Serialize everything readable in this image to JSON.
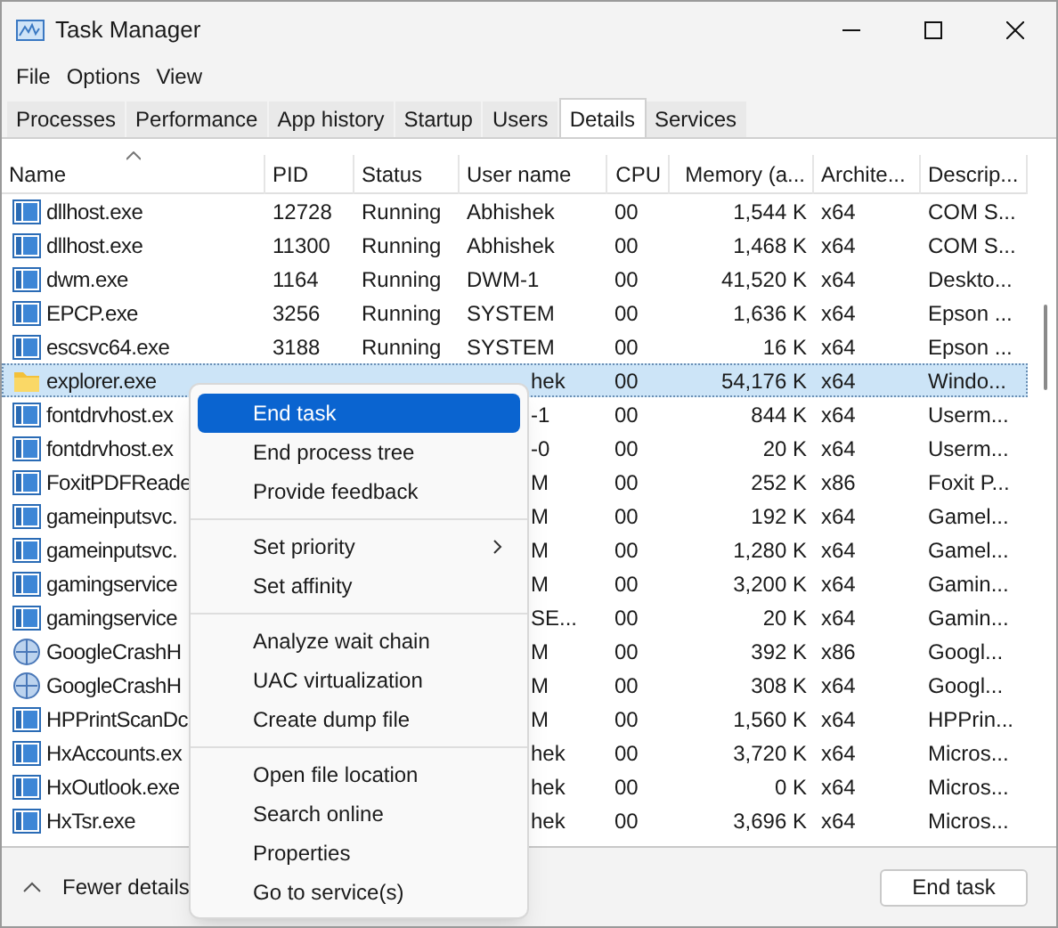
{
  "window": {
    "title": "Task Manager"
  },
  "menu_bar": [
    "File",
    "Options",
    "View"
  ],
  "tabs": [
    {
      "label": "Processes",
      "selected": false
    },
    {
      "label": "Performance",
      "selected": false
    },
    {
      "label": "App history",
      "selected": false
    },
    {
      "label": "Startup",
      "selected": false
    },
    {
      "label": "Users",
      "selected": false
    },
    {
      "label": "Details",
      "selected": true
    },
    {
      "label": "Services",
      "selected": false
    }
  ],
  "table": {
    "columns": [
      "Name",
      "PID",
      "Status",
      "User name",
      "CPU",
      "Memory (a...",
      "Archite...",
      "Descrip..."
    ],
    "rows": [
      {
        "kind": "app",
        "name": "dllhost.exe",
        "pid": "12728",
        "status": "Running",
        "user": "Abhishek",
        "cpu": "00",
        "memory": "1,544 K",
        "arch": "x64",
        "description": "COM S...",
        "selected": false
      },
      {
        "kind": "app",
        "name": "dllhost.exe",
        "pid": "11300",
        "status": "Running",
        "user": "Abhishek",
        "cpu": "00",
        "memory": "1,468 K",
        "arch": "x64",
        "description": "COM S...",
        "selected": false
      },
      {
        "kind": "app",
        "name": "dwm.exe",
        "pid": "1164",
        "status": "Running",
        "user": "DWM-1",
        "cpu": "00",
        "memory": "41,520 K",
        "arch": "x64",
        "description": "Deskto...",
        "selected": false
      },
      {
        "kind": "app",
        "name": "EPCP.exe",
        "pid": "3256",
        "status": "Running",
        "user": "SYSTEM",
        "cpu": "00",
        "memory": "1,636 K",
        "arch": "x64",
        "description": "Epson ...",
        "selected": false
      },
      {
        "kind": "app",
        "name": "escsvc64.exe",
        "pid": "3188",
        "status": "Running",
        "user": "SYSTEM",
        "cpu": "00",
        "memory": "16 K",
        "arch": "x64",
        "description": "Epson ...",
        "selected": false
      },
      {
        "kind": "folder",
        "name": "explorer.exe",
        "user": "hek",
        "cpu": "00",
        "memory": "54,176 K",
        "arch": "x64",
        "description": "Windo...",
        "selected": true
      },
      {
        "kind": "app",
        "name": "fontdrvhost.ex",
        "user": "-1",
        "cpu": "00",
        "memory": "844 K",
        "arch": "x64",
        "description": "Userm...",
        "selected": false
      },
      {
        "kind": "app",
        "name": "fontdrvhost.ex",
        "user": "-0",
        "cpu": "00",
        "memory": "20 K",
        "arch": "x64",
        "description": "Userm...",
        "selected": false
      },
      {
        "kind": "app",
        "name": "FoxitPDFReade",
        "user": "M",
        "cpu": "00",
        "memory": "252 K",
        "arch": "x86",
        "description": "Foxit P...",
        "selected": false
      },
      {
        "kind": "app",
        "name": "gameinputsvc.",
        "user": "M",
        "cpu": "00",
        "memory": "192 K",
        "arch": "x64",
        "description": "Gamel...",
        "selected": false
      },
      {
        "kind": "app",
        "name": "gameinputsvc.",
        "user": "M",
        "cpu": "00",
        "memory": "1,280 K",
        "arch": "x64",
        "description": "Gamel...",
        "selected": false
      },
      {
        "kind": "app",
        "name": "gamingservice",
        "user": "M",
        "cpu": "00",
        "memory": "3,200 K",
        "arch": "x64",
        "description": "Gamin...",
        "selected": false
      },
      {
        "kind": "app",
        "name": "gamingservice",
        "user": "SE...",
        "cpu": "00",
        "memory": "20 K",
        "arch": "x64",
        "description": "Gamin...",
        "selected": false
      },
      {
        "kind": "crash",
        "name": "GoogleCrashH",
        "user": "M",
        "cpu": "00",
        "memory": "392 K",
        "arch": "x86",
        "description": "Googl...",
        "selected": false
      },
      {
        "kind": "crash",
        "name": "GoogleCrashH",
        "user": "M",
        "cpu": "00",
        "memory": "308 K",
        "arch": "x64",
        "description": "Googl...",
        "selected": false
      },
      {
        "kind": "app",
        "name": "HPPrintScanDc",
        "user": "M",
        "cpu": "00",
        "memory": "1,560 K",
        "arch": "x64",
        "description": "HPPrin...",
        "selected": false
      },
      {
        "kind": "app",
        "name": "HxAccounts.ex",
        "user": "hek",
        "cpu": "00",
        "memory": "3,720 K",
        "arch": "x64",
        "description": "Micros...",
        "selected": false
      },
      {
        "kind": "app",
        "name": "HxOutlook.exe",
        "user": "hek",
        "cpu": "00",
        "memory": "0 K",
        "arch": "x64",
        "description": "Micros...",
        "selected": false
      },
      {
        "kind": "app",
        "name": "HxTsr.exe",
        "user": "hek",
        "cpu": "00",
        "memory": "3,696 K",
        "arch": "x64",
        "description": "Micros...",
        "selected": false
      }
    ]
  },
  "context_menu": {
    "groups": [
      [
        {
          "label": "End task",
          "selected": true,
          "submenu": false
        },
        {
          "label": "End process tree",
          "selected": false,
          "submenu": false
        },
        {
          "label": "Provide feedback",
          "selected": false,
          "submenu": false
        }
      ],
      [
        {
          "label": "Set priority",
          "selected": false,
          "submenu": true
        },
        {
          "label": "Set affinity",
          "selected": false,
          "submenu": false
        }
      ],
      [
        {
          "label": "Analyze wait chain",
          "selected": false,
          "submenu": false
        },
        {
          "label": "UAC virtualization",
          "selected": false,
          "submenu": false
        },
        {
          "label": "Create dump file",
          "selected": false,
          "submenu": false
        }
      ],
      [
        {
          "label": "Open file location",
          "selected": false,
          "submenu": false
        },
        {
          "label": "Search online",
          "selected": false,
          "submenu": false
        },
        {
          "label": "Properties",
          "selected": false,
          "submenu": false
        },
        {
          "label": "Go to service(s)",
          "selected": false,
          "submenu": false
        }
      ]
    ]
  },
  "footer": {
    "toggle": "Fewer details",
    "button": "End task"
  }
}
